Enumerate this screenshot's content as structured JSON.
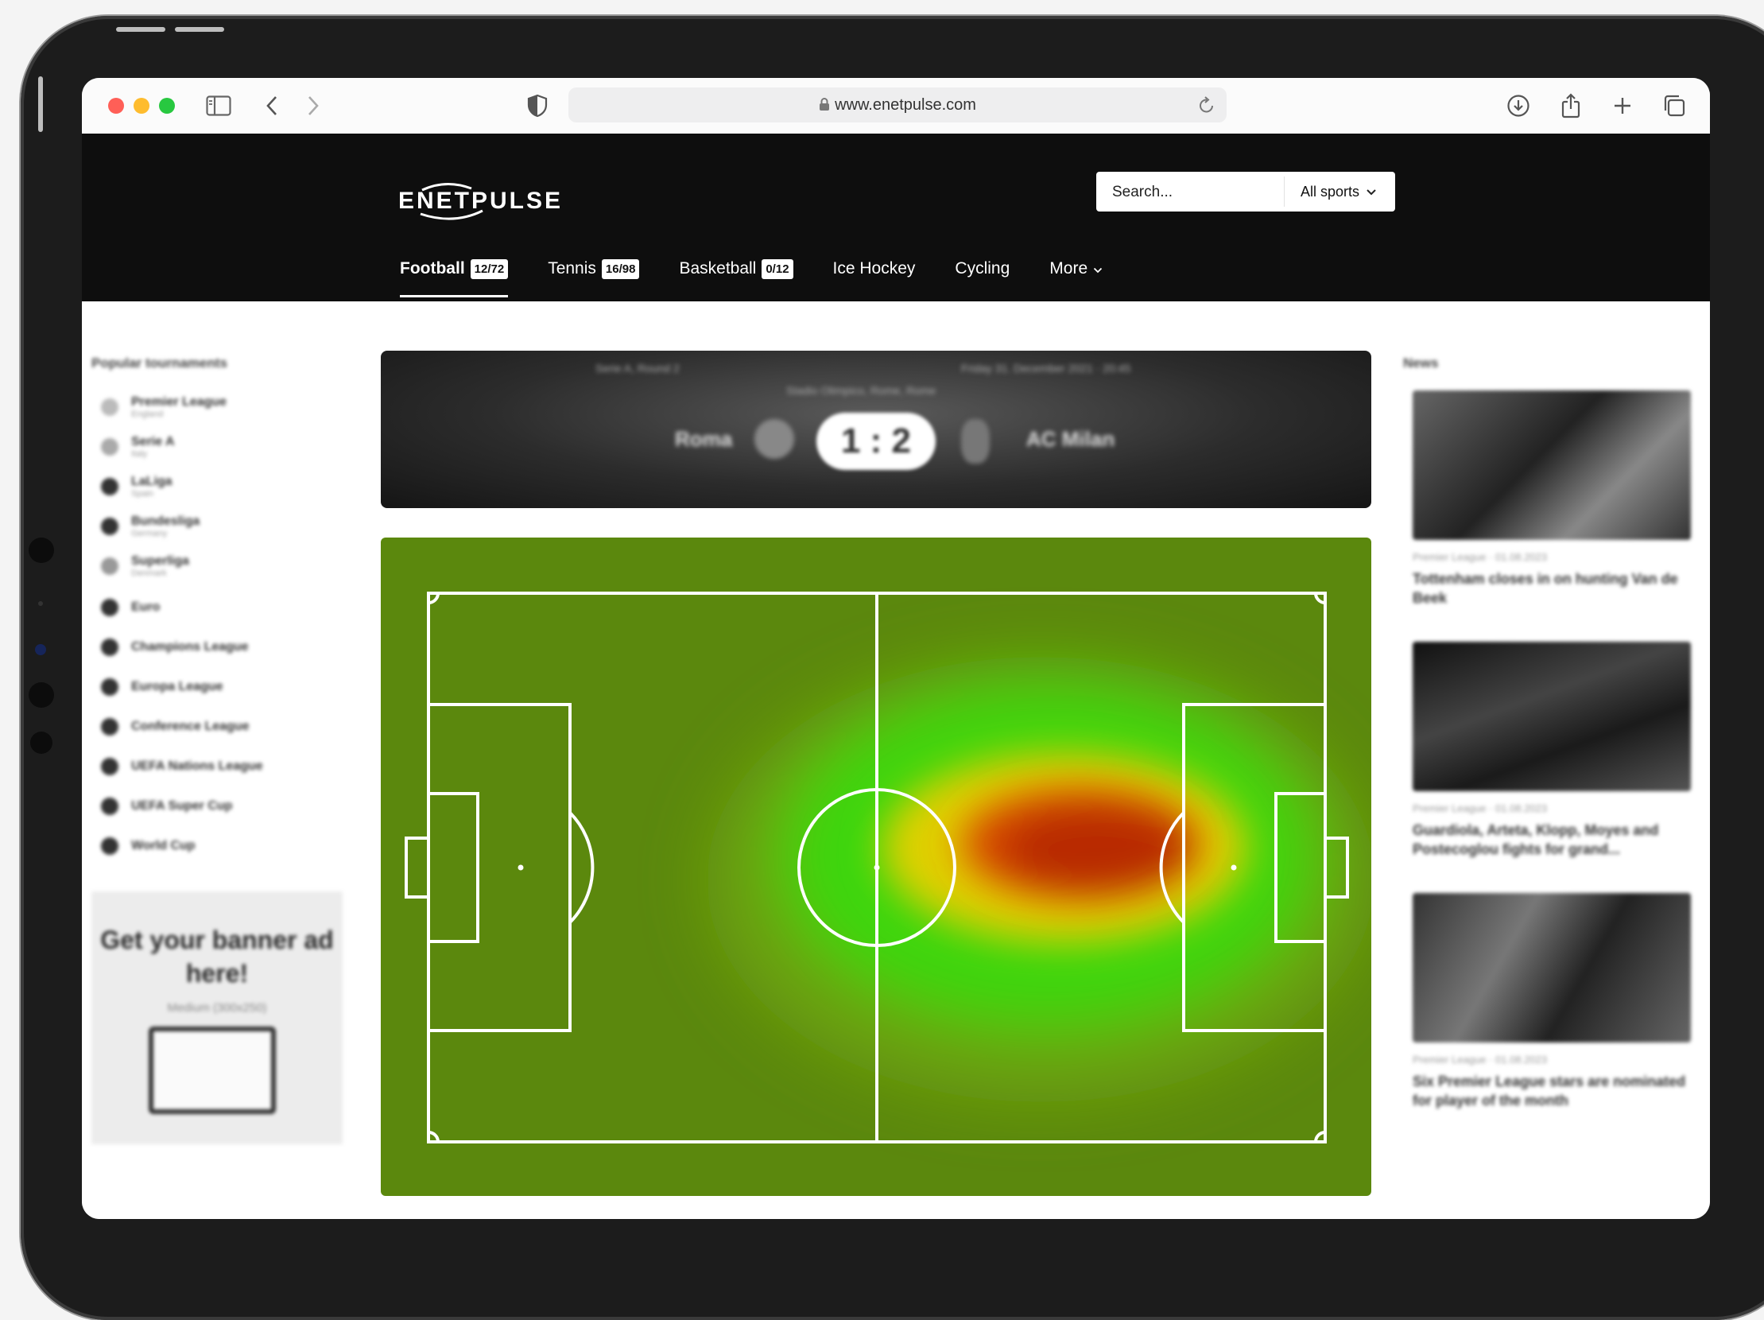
{
  "browser": {
    "url": "www.enetpulse.com",
    "traffic_lights": [
      "#ff5f57",
      "#febc2e",
      "#28c840"
    ]
  },
  "site": {
    "brand": "ENETPULSE",
    "search": {
      "placeholder": "Search...",
      "sport_filter": "All sports"
    },
    "nav": [
      {
        "label": "Football",
        "badge": "12/72",
        "active": true
      },
      {
        "label": "Tennis",
        "badge": "16/98"
      },
      {
        "label": "Basketball",
        "badge": "0/12"
      },
      {
        "label": "Ice Hockey"
      },
      {
        "label": "Cycling"
      },
      {
        "label": "More"
      }
    ]
  },
  "sidebar": {
    "title": "Popular tournaments",
    "tournaments": [
      {
        "label": "Premier League",
        "sub": "England"
      },
      {
        "label": "Serie A",
        "sub": "Italy"
      },
      {
        "label": "LaLiga",
        "sub": "Spain"
      },
      {
        "label": "Bundesliga",
        "sub": "Germany"
      },
      {
        "label": "Superliga",
        "sub": "Denmark"
      },
      {
        "label": "Euro"
      },
      {
        "label": "Champions League"
      },
      {
        "label": "Europa League"
      },
      {
        "label": "Conference League"
      },
      {
        "label": "UEFA Nations League"
      },
      {
        "label": "UEFA Super Cup"
      },
      {
        "label": "World Cup"
      }
    ],
    "ad": {
      "title": "Get your banner ad here!",
      "subtitle": "Medium (300x250)"
    }
  },
  "match": {
    "round": "Serie A, Round 2",
    "datetime": "Friday 31. December 2021 · 20:45",
    "venue": "Stadio Olimpico, Rome, Rome",
    "home_team": "Roma",
    "away_team": "AC Milan",
    "score": "1 : 2"
  },
  "heatmap": {
    "hotspot_color": "#b82a04",
    "mid_color": "#e0d000",
    "cool_color": "#3ed60c",
    "pitch_color": "#5b880d"
  },
  "news": {
    "title": "News",
    "items": [
      {
        "meta": "Premier League · 01.08.2023",
        "headline": "Tottenham closes in on hunting Van de Beek"
      },
      {
        "meta": "Premier League · 01.08.2023",
        "headline": "Guardiola, Arteta, Klopp, Moyes and Postecoglou fights for grand..."
      },
      {
        "meta": "Premier League · 01.08.2023",
        "headline": "Six Premier League stars are nominated for player of the month"
      }
    ]
  }
}
